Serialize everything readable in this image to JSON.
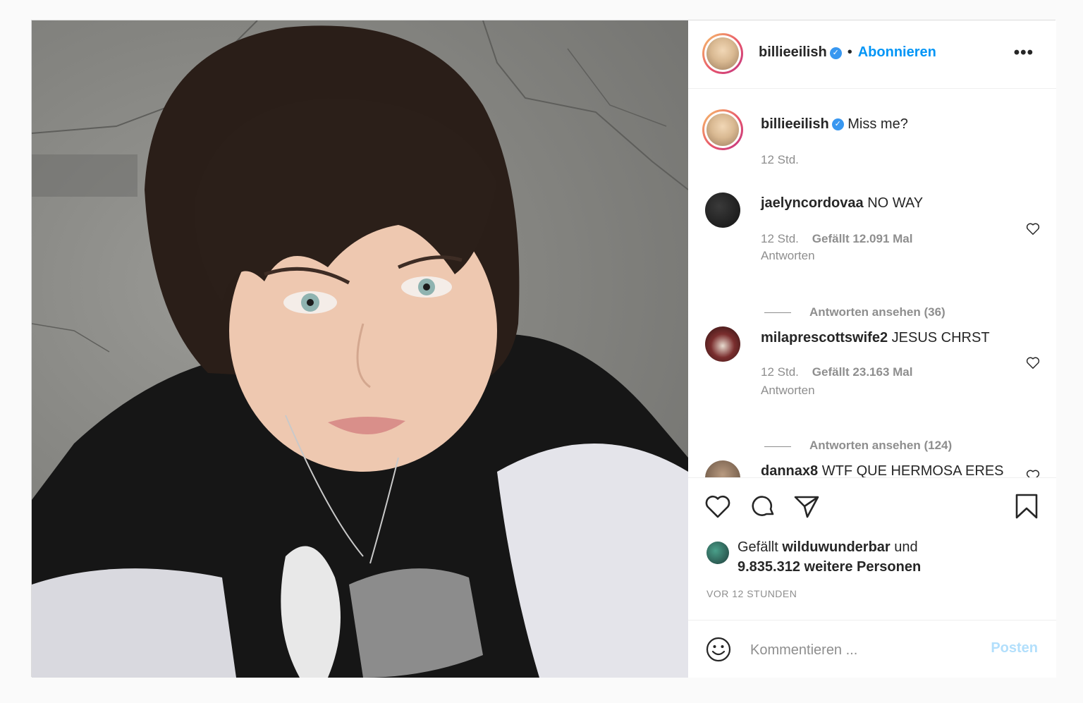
{
  "post": {
    "username": "billieeilish",
    "follow_label": "Abonnieren",
    "separator": "•",
    "more_label": "•••"
  },
  "caption": {
    "username": "billieeilish",
    "text": "Miss me?",
    "time": "12 Std."
  },
  "comments": [
    {
      "username": "jaelyncordovaa",
      "text": "NO WAY",
      "time": "12 Std.",
      "likes": "Gefällt 12.091 Mal",
      "reply": "Antworten",
      "view_replies": "Antworten ansehen (36)"
    },
    {
      "username": "milaprescottswife2",
      "text": "JESUS CHRST",
      "time": "12 Std.",
      "likes": "Gefällt 23.163 Mal",
      "reply": "Antworten",
      "view_replies": "Antworten ansehen (124)"
    },
    {
      "username": "dannax8",
      "text": "WTF QUE HERMOSA ERES"
    }
  ],
  "likes": {
    "prefix": "Gefällt",
    "user": "wilduwunderbar",
    "middle": "und",
    "count": "9.835.312 weitere Personen"
  },
  "timestamp": "VOR 12 STUNDEN",
  "composer": {
    "placeholder": "Kommentieren ...",
    "post_label": "Posten"
  },
  "icons": {
    "like": "heart-icon",
    "comment": "comment-bubble-icon",
    "share": "paper-plane-icon",
    "save": "bookmark-icon",
    "emoji": "smiley-icon",
    "verified": "verified-badge-icon"
  },
  "colors": {
    "link_blue": "#0095f6",
    "verified_blue": "#3897f0",
    "muted_text": "#8e8e8e",
    "post_disabled": "#b2dffc"
  }
}
